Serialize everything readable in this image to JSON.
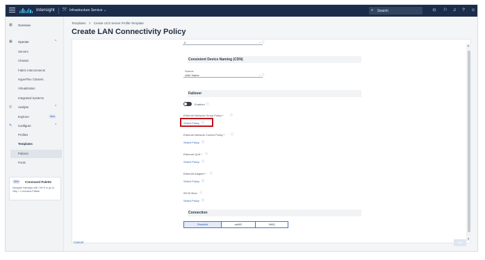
{
  "topbar": {
    "brand": "Intersight",
    "service": "Infrastructure Service  ⌄",
    "search_placeholder": "Search",
    "icons": [
      "menu-icon",
      "service-icon",
      "search-icon",
      "check-circle-icon",
      "announcement-icon",
      "bell-icon",
      "help-icon",
      "user-icon"
    ]
  },
  "sidebar": {
    "overview": "Overview",
    "operate": "Operate",
    "operate_items": [
      "Servers",
      "Chassis",
      "Fabric Interconnects",
      "HyperFlex Clusters",
      "Virtualization",
      "Integrated Systems"
    ],
    "analyze": "Analyze",
    "explorer": "Explorer",
    "new_badge": "New",
    "configure": "Configure",
    "configure_items": [
      "Profiles",
      "Templates",
      "Policies",
      "Pools"
    ],
    "palette": {
      "badge": "New",
      "title": "Command Palette",
      "desc": "Navigate Intersight with Ctrl+K or go to Help > Command Palette"
    }
  },
  "page": {
    "breadcrumb": [
      "Templates",
      ">",
      "Create UCS Server Profile Template"
    ],
    "title": "Create LAN Connectivity Policy"
  },
  "form": {
    "top_value": "0",
    "cdn_section": "Consistent Device Naming (CDN)",
    "source_label": "Source",
    "source_value": "vNIC Name",
    "failover_section": "Failover",
    "toggle_label": "Enabled",
    "policies": [
      {
        "label": "Ethernet Network Group Policy *",
        "link": "Select Policy"
      },
      {
        "label": "Ethernet Network Control Policy *",
        "link": "Select Policy"
      },
      {
        "label": "Ethernet QoS *",
        "link": "Select Policy"
      },
      {
        "label": "Ethernet Adapter *",
        "link": "Select Policy"
      },
      {
        "label": "iSCSI Boot",
        "link": "Select Policy"
      }
    ],
    "connection_section": "Connection",
    "connection_options": [
      "Disabled",
      "usNIC",
      "VMQ"
    ],
    "connection_selected": "Disabled"
  },
  "footer": {
    "cancel": "Cancel",
    "add": "Add"
  },
  "colors": {
    "topbar": "#1b2d4a",
    "link": "#2b5fbf",
    "highlight": "#c0141a"
  }
}
